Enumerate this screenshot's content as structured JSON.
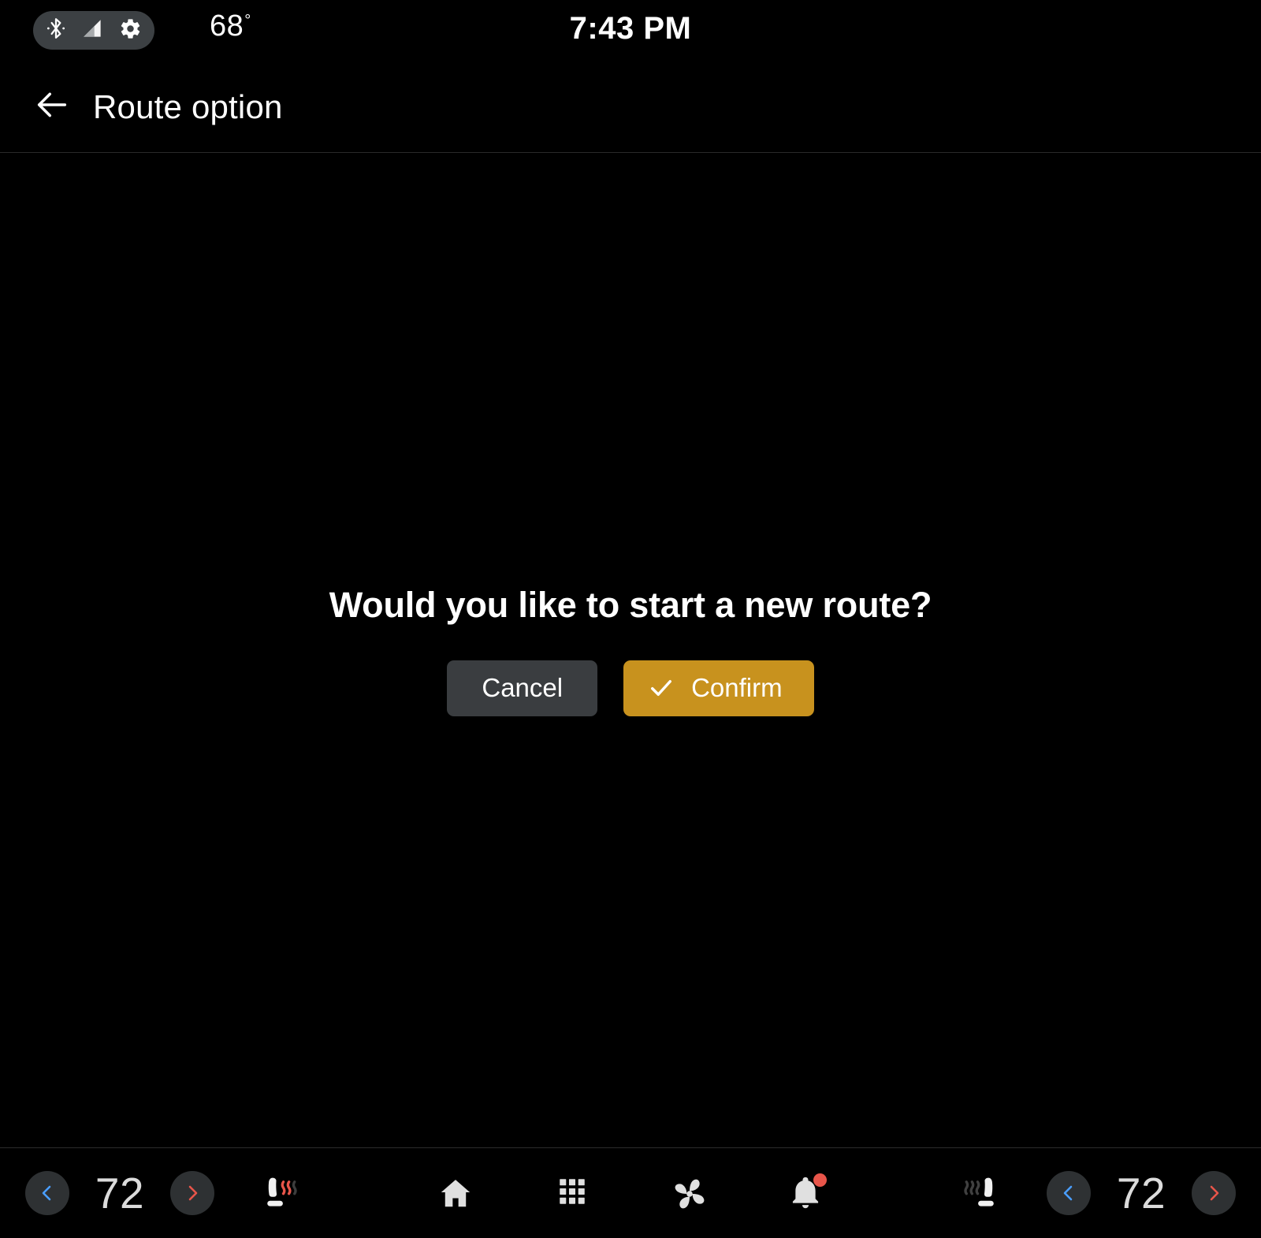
{
  "status_bar": {
    "bluetooth_icon": "bluetooth-icon",
    "signal_icon": "cell-signal-icon",
    "settings_icon": "gear-icon",
    "temperature": "68",
    "degree_symbol": "°",
    "clock": "7:43 PM"
  },
  "header": {
    "back_icon": "back-arrow-icon",
    "title": "Route option"
  },
  "dialog": {
    "message": "Would you like to start a new route?",
    "cancel_label": "Cancel",
    "confirm_label": "Confirm",
    "confirm_icon": "check-icon",
    "confirm_color": "#c8921e",
    "cancel_color": "#3a3d40"
  },
  "bottom_bar": {
    "driver_climate": {
      "decrease_icon": "chevron-left-icon",
      "temperature": "72",
      "increase_icon": "chevron-right-icon",
      "decrease_color": "#4a9eff",
      "increase_color": "#e8554a"
    },
    "driver_seat_heater": {
      "icon": "seat-heater-icon",
      "state": "active",
      "wave_color": "#e8554a"
    },
    "nav": [
      {
        "icon": "home-icon",
        "name": "home"
      },
      {
        "icon": "apps-grid-icon",
        "name": "apps"
      },
      {
        "icon": "climate-fan-icon",
        "name": "climate"
      },
      {
        "icon": "notifications-bell-icon",
        "name": "notifications",
        "badge": true
      }
    ],
    "passenger_seat_heater": {
      "icon": "seat-heater-icon",
      "state": "inactive",
      "wave_color": "#3d3d3d"
    },
    "passenger_climate": {
      "decrease_icon": "chevron-left-icon",
      "temperature": "72",
      "increase_icon": "chevron-right-icon",
      "decrease_color": "#4a9eff",
      "increase_color": "#e8554a"
    }
  }
}
